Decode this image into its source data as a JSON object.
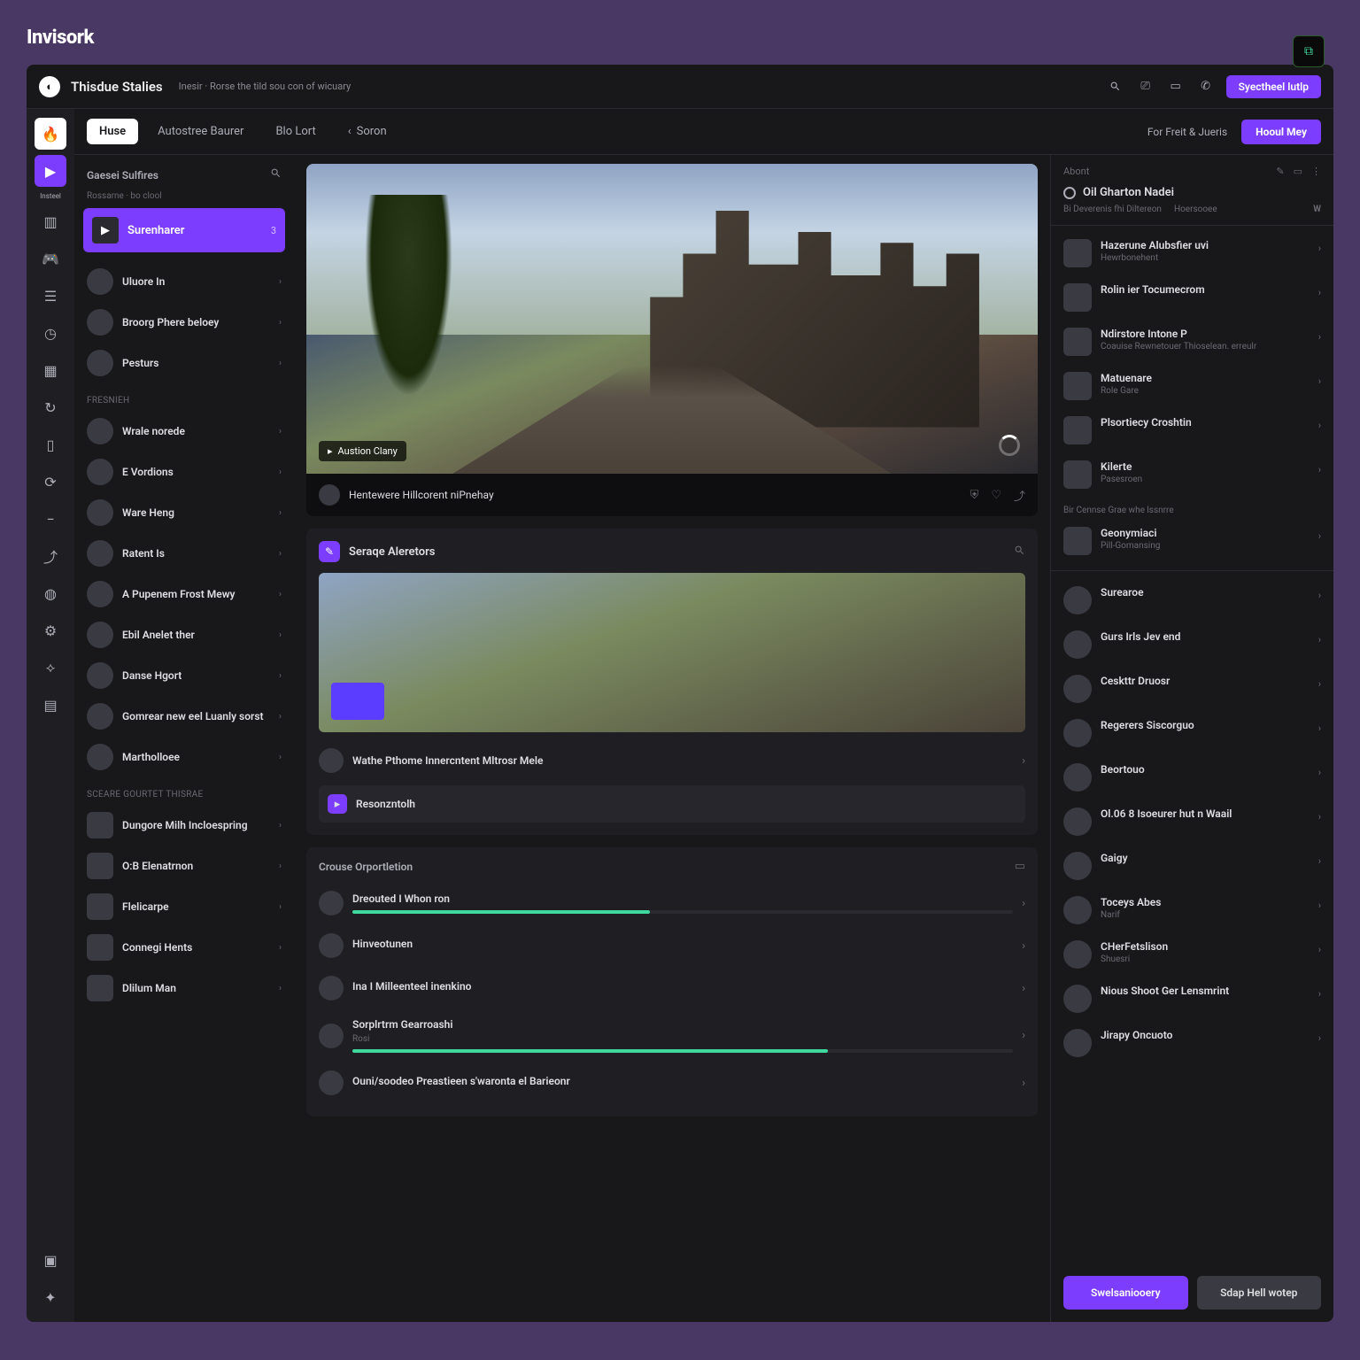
{
  "brand": "Invisork",
  "titlebar": {
    "title": "Thisdue Stalies",
    "subtitle": "Inesir · Rorse the tild sou con of wicuary",
    "cta": "Syectheel lutlp"
  },
  "tabs": {
    "items": [
      "Huse",
      "Autostree Baurer",
      "Blo Lort",
      "Soron"
    ],
    "link": "For Freit & Jueris",
    "cta": "Hooul Mey"
  },
  "rail": {
    "label": "Insteel"
  },
  "left": {
    "header": "Gaesei Sulfires",
    "sub": "Rossarne · bo clool",
    "featured": {
      "name": "Surenharer",
      "count": "3"
    },
    "items": [
      {
        "name": "Uluore In",
        "sub": ""
      },
      {
        "name": "Broorg Phere beloey",
        "sub": ""
      },
      {
        "name": "Pesturs",
        "sub": ""
      }
    ],
    "section1": "Fresnieh",
    "items2": [
      {
        "name": "Wrale norede",
        "sub": ""
      },
      {
        "name": "E Vordions",
        "sub": ""
      },
      {
        "name": "Ware Heng",
        "sub": ""
      },
      {
        "name": "Ratent Is",
        "sub": ""
      },
      {
        "name": "A Pupenem Frost Mewy",
        "sub": ""
      },
      {
        "name": "Ebil Anelet ther",
        "sub": ""
      },
      {
        "name": "Danse Hgort",
        "sub": ""
      },
      {
        "name": "Gomrear new eel Luanly sorst",
        "sub": ""
      },
      {
        "name": "Martholloee",
        "sub": ""
      }
    ],
    "section2": "Sceare Gourtet Thisrae",
    "items3": [
      {
        "name": "Dungore Milh Incloespring",
        "sub": ""
      },
      {
        "name": "O:B Elenatrnon",
        "sub": ""
      },
      {
        "name": "Flelicarpe",
        "sub": ""
      },
      {
        "name": "Connegi Hents",
        "sub": ""
      },
      {
        "name": "Dlilum Man",
        "sub": ""
      }
    ]
  },
  "hero": {
    "tag": "Austion Clany",
    "streamer": "Hentewere Hillcorent niPnehay"
  },
  "card2": {
    "title": "Seraqe Aleretors",
    "row_name": "Wathe Pthome Innercntent Mltrosr Mele",
    "row_sub": "",
    "box_name": "Resonzntolh"
  },
  "progress": {
    "title": "Crouse Orportletion",
    "rows": [
      {
        "name": "Dreouted I Whon ron",
        "sub": "",
        "pct": 45
      },
      {
        "name": "Hinveotunen",
        "sub": "",
        "pct": 0
      },
      {
        "name": "Ina I Milleenteel inenkino",
        "sub": "",
        "pct": 0
      },
      {
        "name": "Sorplrtrm Gearroashi",
        "sub": "Rosi",
        "pct": 72
      },
      {
        "name": "Ouni/soodeo Preastieen  s'waronta el Barieonr",
        "sub": "",
        "pct": 0
      }
    ]
  },
  "right": {
    "toptab": "Abont",
    "title": "Oil Gharton Nadei",
    "tabs": [
      "Bi Deverenis fhi Diltereon",
      "Hoersooee"
    ],
    "items": [
      {
        "name": "Hazerune Alubsfier uvi",
        "sub": "Hewrbonehent"
      },
      {
        "name": "Rolin ier Tocumecrom",
        "sub": ""
      },
      {
        "name": "Ndirstore Intone P",
        "sub": "Coauise Rewnetouer Thioselean. erreulr"
      },
      {
        "name": "Matuenare",
        "sub": "Role Gare"
      },
      {
        "name": "Plsortiecy Croshtin",
        "sub": ""
      },
      {
        "name": "Kilerte",
        "sub": "Pasesroen"
      }
    ],
    "section1": "Bir Cennse Grae whe lssnrre",
    "items2": [
      {
        "name": "Geonymiaci",
        "sub": "Pill-Gomansing"
      }
    ],
    "items3": [
      {
        "name": "Surearoe",
        "sub": ""
      },
      {
        "name": "Gurs Irls Jev end",
        "sub": ""
      },
      {
        "name": "Ceskttr Druosr",
        "sub": ""
      },
      {
        "name": "Regerers Siscorguo",
        "sub": ""
      },
      {
        "name": "Beortouo",
        "sub": ""
      },
      {
        "name": "Ol.06 8 Isoeurer hut n Waail",
        "sub": ""
      },
      {
        "name": "Gaigy",
        "sub": ""
      },
      {
        "name": "Toceys Abes",
        "sub": "Narif"
      },
      {
        "name": "CHerFetslison",
        "sub": "Shuesri"
      },
      {
        "name": "Nious Shoot Ger Lensmrint",
        "sub": ""
      },
      {
        "name": "Jirapy Oncuoto",
        "sub": ""
      }
    ],
    "footer": {
      "primary": "Swelsaniooery",
      "secondary": "Sdap Hell wotep"
    }
  }
}
